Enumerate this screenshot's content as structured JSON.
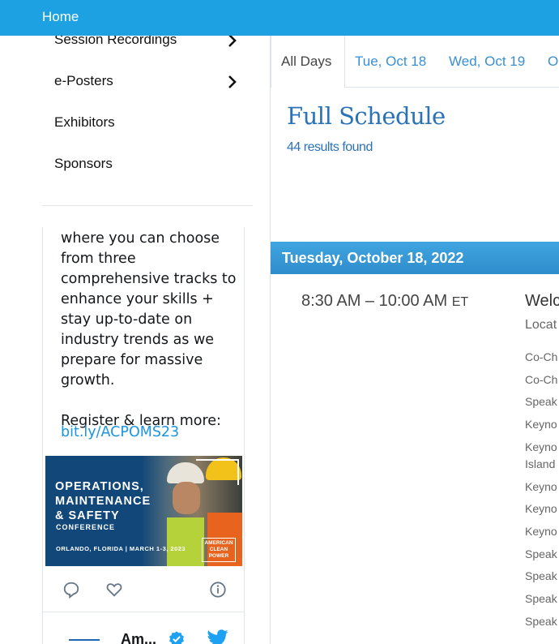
{
  "topbar": {
    "home_label": "Home"
  },
  "sidebar": {
    "items": [
      {
        "label": "Session Recordings",
        "has_chevron": true
      },
      {
        "label": "e-Posters",
        "has_chevron": true
      },
      {
        "label": "Exhibitors",
        "has_chevron": false
      },
      {
        "label": "Sponsors",
        "has_chevron": false
      }
    ]
  },
  "tweet": {
    "text": "where you can choose from three comprehensive tracks to enhance your skills + stay up-to-date on industry trends as we prepare for massive growth.\n\nRegister & learn more:",
    "link": "bit.ly/ACPOMS23",
    "banner": {
      "title": "OPERATIONS,\nMAINTENANCE\n& SAFETY",
      "subtitle": "CONFERENCE",
      "date_line": "ORLANDO, FLORIDA  |  MARCH 1-3, 2023",
      "logo_text": "AMERICAN\nCLEAN\nPOWER"
    },
    "author_name": "Am...",
    "icons": [
      "reply-icon",
      "like-icon",
      "info-icon",
      "verified-icon",
      "twitter-bird-icon"
    ]
  },
  "tabs": [
    {
      "label": "All Days",
      "active": true
    },
    {
      "label": "Tue, Oct 18",
      "active": false
    },
    {
      "label": "Wed, Oct 19",
      "active": false
    },
    {
      "label": "O",
      "active": false
    }
  ],
  "schedule": {
    "title": "Full Schedule",
    "results": "44 results found",
    "day_header": "Tuesday, October 18, 2022",
    "session": {
      "time": "8:30 AM – 10:00 AM",
      "tz": "ET",
      "title": "Welc",
      "location": "Locat",
      "roles": [
        "Co-Ch",
        "Co-Ch",
        "Speak",
        "Keyno",
        "Keyno",
        "Island",
        "Keyno",
        "Keyno",
        "Keyno",
        "Speak",
        "Speak",
        "Speak",
        "Speak"
      ]
    }
  },
  "colors": {
    "accent": "#1da1e2",
    "link": "#2b72b6",
    "day_band": "#3a9ad8"
  }
}
